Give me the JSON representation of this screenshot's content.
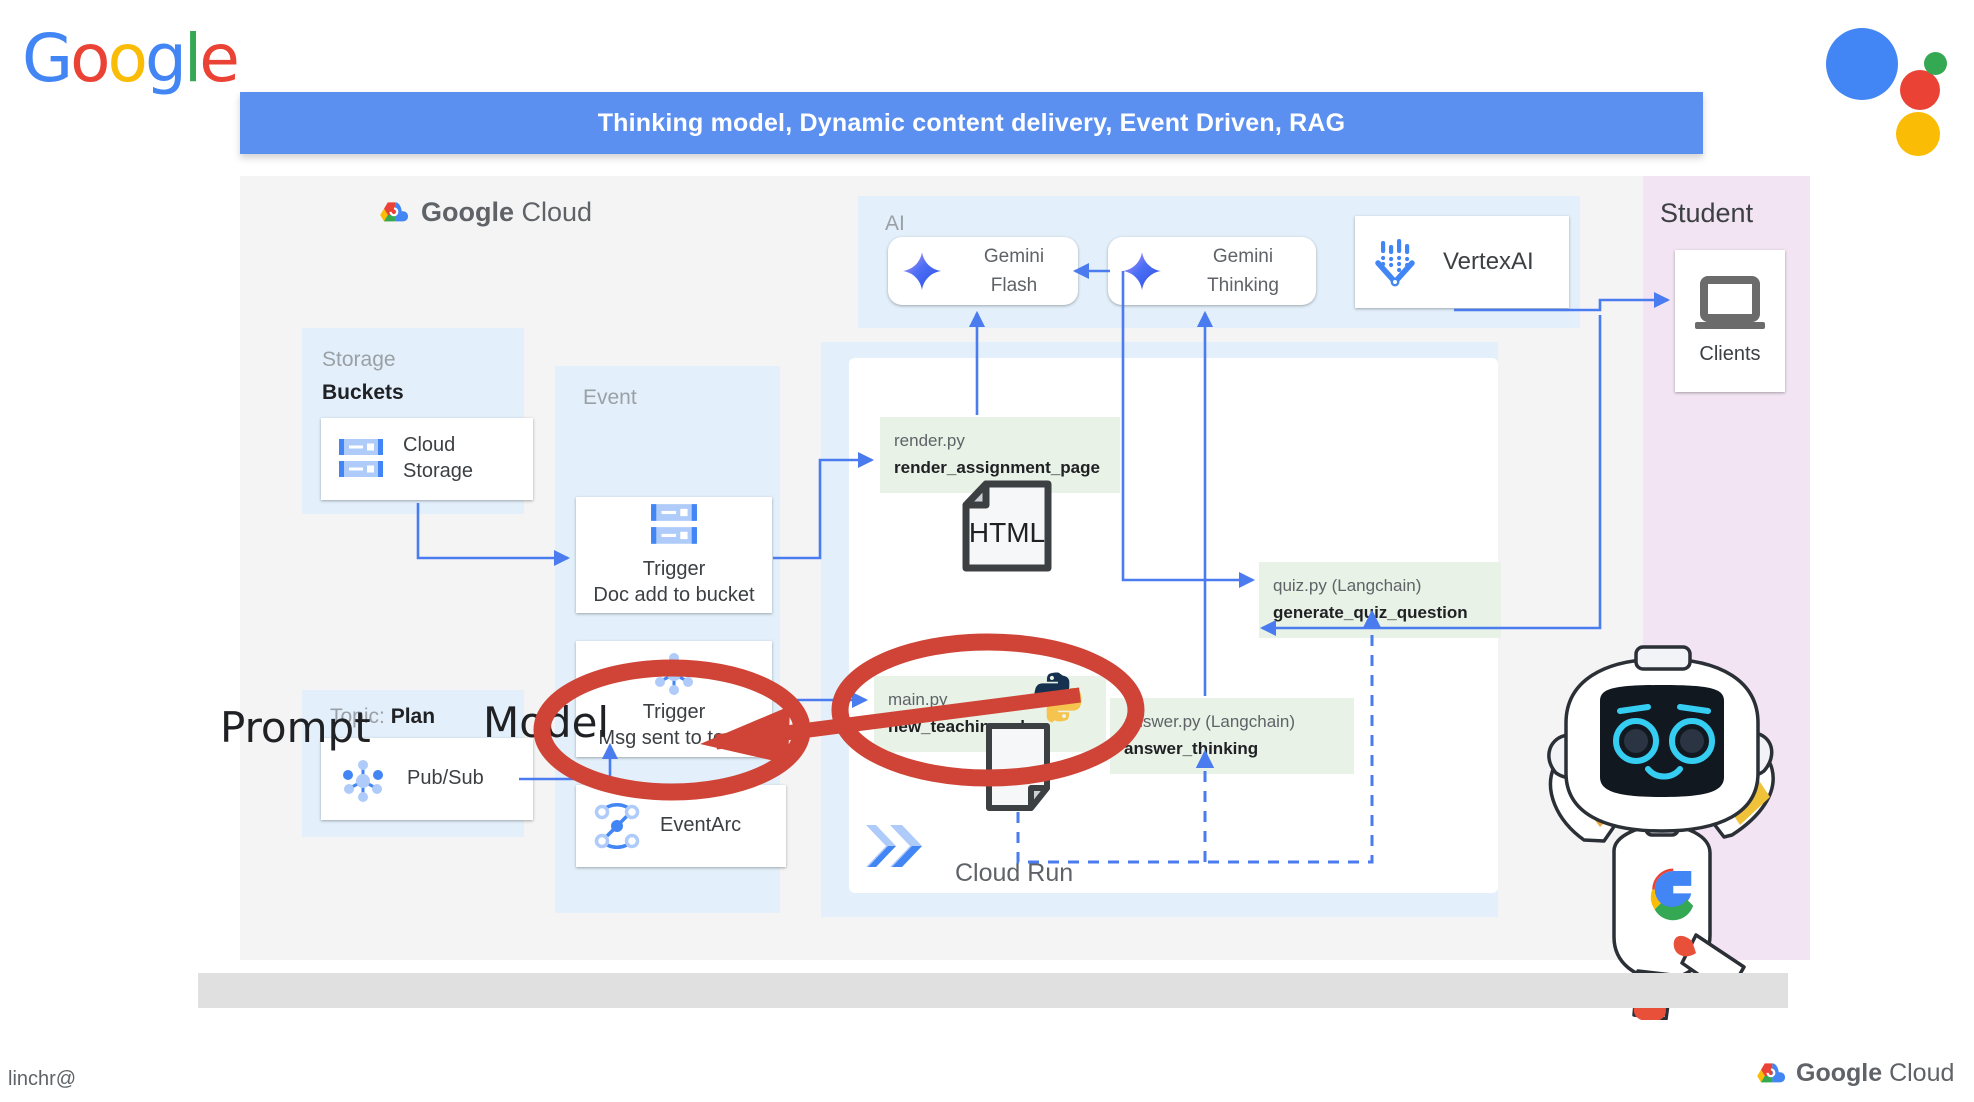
{
  "brand": {
    "wordmark": "Google",
    "assistant_dots_icon": "google-assistant-dots-icon",
    "colors": {
      "blue": "#4285F4",
      "red": "#EA4335",
      "yellow": "#FBBC05",
      "green": "#34A853"
    }
  },
  "title_banner": {
    "text": "Thinking model, Dynamic content delivery, Event Driven, RAG",
    "background": "#5b8ff0",
    "text_color": "#ffffff"
  },
  "diagram": {
    "platform_label": {
      "brand": "Google",
      "product": "Cloud"
    },
    "groups": {
      "storage": {
        "title": "Storage",
        "subtitle": "Buckets"
      },
      "topic": {
        "title": "Topic:",
        "subtitle": "Plan"
      },
      "event": {
        "title": "Event"
      },
      "ai": {
        "title": "AI"
      },
      "cloud_run": {
        "title": "Cloud Run"
      },
      "student": {
        "title": "Student"
      }
    },
    "cards": {
      "cloud_storage": {
        "label_line1": "Cloud",
        "label_line2": "Storage",
        "icon": "cloud-storage-icon"
      },
      "pubsub": {
        "label": "Pub/Sub",
        "icon": "pubsub-icon"
      },
      "trigger_doc": {
        "label_line1": "Trigger",
        "label_line2": "Doc add to bucket",
        "icon": "cloud-storage-icon"
      },
      "trigger_msg": {
        "label_line1": "Trigger",
        "label_line2": "Msg sent to topic",
        "icon": "pubsub-icon"
      },
      "eventarc": {
        "label": "EventArc",
        "icon": "eventarc-icon"
      },
      "gemini_flash": {
        "label_line1": "Gemini",
        "label_line2": "Flash",
        "icon": "gemini-sparkle-icon"
      },
      "gemini_thinking": {
        "label_line1": "Gemini",
        "label_line2": "Thinking",
        "icon": "gemini-sparkle-icon"
      },
      "vertexai": {
        "label": "VertexAI",
        "icon": "vertexai-icon"
      },
      "clients": {
        "label": "Clients",
        "icon": "laptop-icon"
      }
    },
    "code_boxes": [
      {
        "id": "render",
        "file": "render.py",
        "function": "render_assignment_page"
      },
      {
        "id": "quiz",
        "file": "quiz.py (Langchain)",
        "function": "generate_quiz_question"
      },
      {
        "id": "main",
        "file": "main.py",
        "function": "new_teaching_plan"
      },
      {
        "id": "answer",
        "file": "answer.py (Langchain)",
        "function": "answer_thinking"
      }
    ],
    "artifacts": {
      "html_doc": "HTML"
    },
    "overlay_words": {
      "prompt": "Prompt",
      "model": "Model"
    },
    "annotations": {
      "highlight_color": "#cf4436",
      "ellipse_1": "trigger-msg-sent-to-topic",
      "ellipse_2": "main-py-new-teaching-plan",
      "arrow": "points-from-main-py-to-trigger"
    }
  },
  "footer": {
    "user": "linchr@",
    "brand": {
      "brand": "Google",
      "product": "Cloud"
    }
  }
}
